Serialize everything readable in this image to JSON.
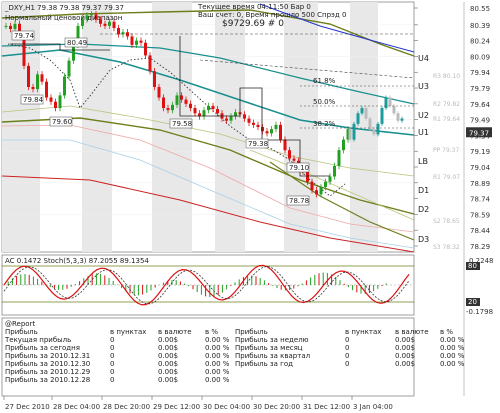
{
  "header": {
    "symbol_line": "_DXY,H1  79.38 79.38 79.37 79.37",
    "range_label": "Нормальный ценовой диапазон",
    "info_line": "Текущее время 04:11:50 Бар 0",
    "info_line2": "Ваш счет: 0, Время прошло 500 Спрэд 0",
    "balance_line": "$9729.69   # 0"
  },
  "price_axis": {
    "ticks": [
      "80.55",
      "80.39",
      "80.24",
      "80.09",
      "79.94",
      "79.79",
      "79.64",
      "79.49",
      "79.34",
      "79.19",
      "79.04",
      "78.89",
      "78.74",
      "78.59",
      "78.44",
      "78.29"
    ],
    "current": "79.37"
  },
  "time_axis": {
    "ticks": [
      "27 Dec 2010",
      "28 Dec 04:00",
      "28 Dec 20:00",
      "29 Dec 12:00",
      "30 Dec 04:00",
      "30 Dec 20:00",
      "31 Dec 12:00",
      "3 Jan 04:00"
    ]
  },
  "level_tags": [
    "U4",
    "U3",
    "U2",
    "U1",
    "LB",
    "D1",
    "D2",
    "D3"
  ],
  "pivot_tags": [
    "R3 80.10",
    "R2 79.82",
    "R1 79.64",
    "PP 79.37",
    "R1 79.07",
    "S2 78.65",
    "S3 78.32"
  ],
  "fib_labels": [
    "61.8%",
    "50.0%",
    "38.2%"
  ],
  "price_labels": [
    "79.74",
    "80.49",
    "79.84",
    "79.60",
    "79.58",
    "79.38",
    "79.10",
    "78.78"
  ],
  "oscillator": {
    "title": "AC 0.1472  Stoch(5,3,3) 87.2055 89.1354",
    "ticks": [
      "0.2248",
      "80",
      "20",
      "-0.1798"
    ]
  },
  "report": {
    "title": "@Report",
    "left_headers": [
      "Прибыль",
      "в пунктах",
      "в валюте",
      "в %"
    ],
    "left_rows": [
      [
        "Текущая прибыль",
        "0",
        "0.00$",
        "0.00 %"
      ],
      [
        "Прибыль за сегодня",
        "0",
        "0.00$",
        "0.00 %"
      ],
      [
        "Прибыль за 2010.12.31",
        "0",
        "0.00$",
        "0.00 %"
      ],
      [
        "Прибыль за 2010.12.30",
        "0",
        "0.00$",
        "0.00 %"
      ],
      [
        "Прибыль за 2010.12.29",
        "0",
        "0.00$",
        "0.00 %"
      ],
      [
        "Прибыль за 2010.12.28",
        "0",
        "0.00$",
        "0.00 %"
      ]
    ],
    "right_headers": [
      "Прибыль",
      "в пунктах",
      "в валюте",
      "в %"
    ],
    "right_rows": [
      [
        "Прибыль за неделю",
        "0",
        "0.00$",
        "0.00 %"
      ],
      [
        "Прибыль за месяц",
        "0",
        "0.00$",
        "0.00 %"
      ],
      [
        "Прибыль за квартал",
        "0",
        "0.00$",
        "0.00 %"
      ],
      [
        "Прибыль за год",
        "0",
        "0.00$",
        "0.00 %"
      ]
    ]
  },
  "colors": {
    "bull": "#22a022",
    "bear": "#dd1111",
    "teal": "#1a8f8f",
    "olive": "#6b7f1a",
    "blue": "#2233cc",
    "dark_red": "#cc2222",
    "tag_bg": "#333333",
    "band": "#e8e8e8"
  }
}
